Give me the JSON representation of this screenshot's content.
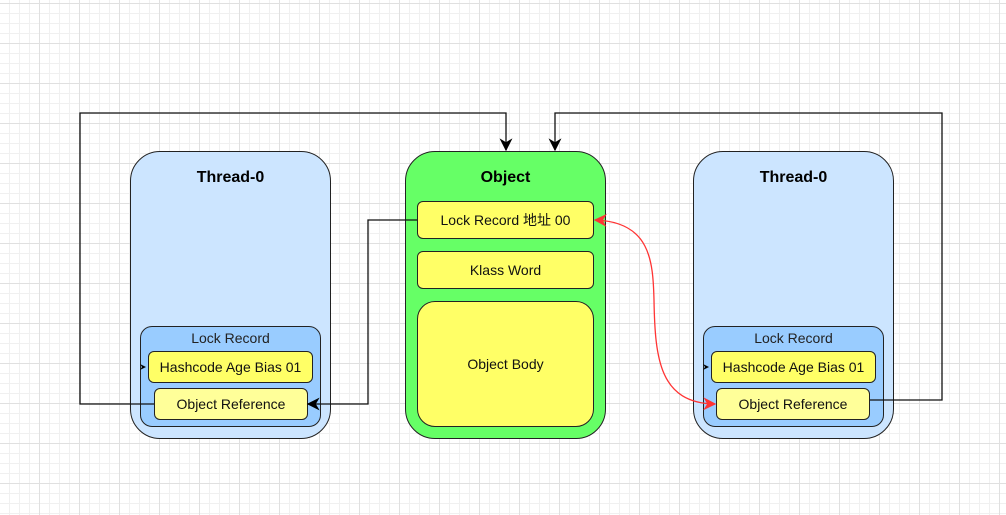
{
  "left_thread": {
    "title": "Thread-0",
    "lock_record": {
      "label": "Lock Record",
      "mark_word": "Hashcode Age Bias 01",
      "object_reference": "Object Reference"
    }
  },
  "object": {
    "title": "Object",
    "mark_word": "Lock Record 地址 00",
    "klass_word": "Klass Word",
    "body": "Object Body"
  },
  "right_thread": {
    "title": "Thread-0",
    "lock_record": {
      "label": "Lock Record",
      "mark_word": "Hashcode Age Bias 01",
      "object_reference": "Object Reference"
    }
  },
  "colors": {
    "thread": "#cce5ff",
    "lock_record": "#99ccff",
    "object": "#66ff66",
    "field": "#ffff66",
    "cas_arrow": "#ff3333"
  }
}
